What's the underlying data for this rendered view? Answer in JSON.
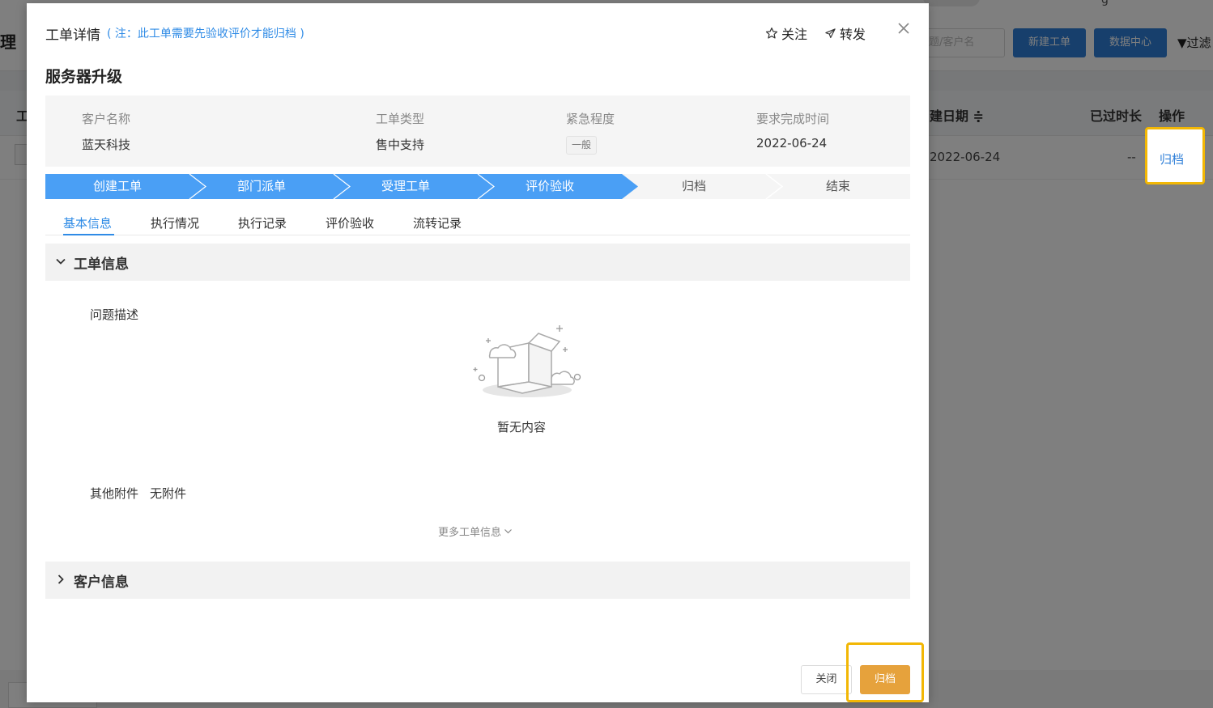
{
  "background": {
    "page_title": "理",
    "top_right_text": "g",
    "search_placeholder": "题/客户名",
    "btn_new_ticket": "新建工单",
    "btn_data_center": "数据中心",
    "filter_label": "▼过滤",
    "table": {
      "col_left": "工",
      "col_create_date": "建日期 ≑",
      "col_elapsed": "已过时长",
      "col_action": "操作",
      "row": {
        "create_date": "2022-06-24",
        "elapsed": "--",
        "action": "归档"
      }
    }
  },
  "modal": {
    "title": "工单详情",
    "note": "( 注：此工单需要先验收评价才能归档 )",
    "follow_label": "关注",
    "forward_label": "转发",
    "subject": "服务器升级",
    "info": {
      "customer_label": "客户名称",
      "customer_value": "蓝天科技",
      "type_label": "工单类型",
      "type_value": "售中支持",
      "urgency_label": "紧急程度",
      "urgency_value": "一般",
      "due_label": "要求完成时间",
      "due_value": "2022-06-24"
    },
    "steps": [
      {
        "label": "创建工单",
        "done": true
      },
      {
        "label": "部门派单",
        "done": true
      },
      {
        "label": "受理工单",
        "done": true
      },
      {
        "label": "评价验收",
        "done": true
      },
      {
        "label": "归档",
        "done": false
      },
      {
        "label": "结束",
        "done": false
      }
    ],
    "tabs": [
      "基本信息",
      "执行情况",
      "执行记录",
      "评价验收",
      "流转记录"
    ],
    "active_tab": "基本信息",
    "section_ticket": {
      "title": "工单信息",
      "problem_label": "问题描述",
      "empty_text": "暂无内容",
      "attachments_label": "其他附件",
      "attachments_value": "无附件",
      "more_info": "更多工单信息"
    },
    "section_customer": {
      "title": "客户信息"
    },
    "close_button": "关闭",
    "archive_button": "归档"
  },
  "colors": {
    "primary": "#2f8be6",
    "step_done": "#4a9ff5",
    "archive": "#e6a23c",
    "highlight": "#f2b705"
  }
}
